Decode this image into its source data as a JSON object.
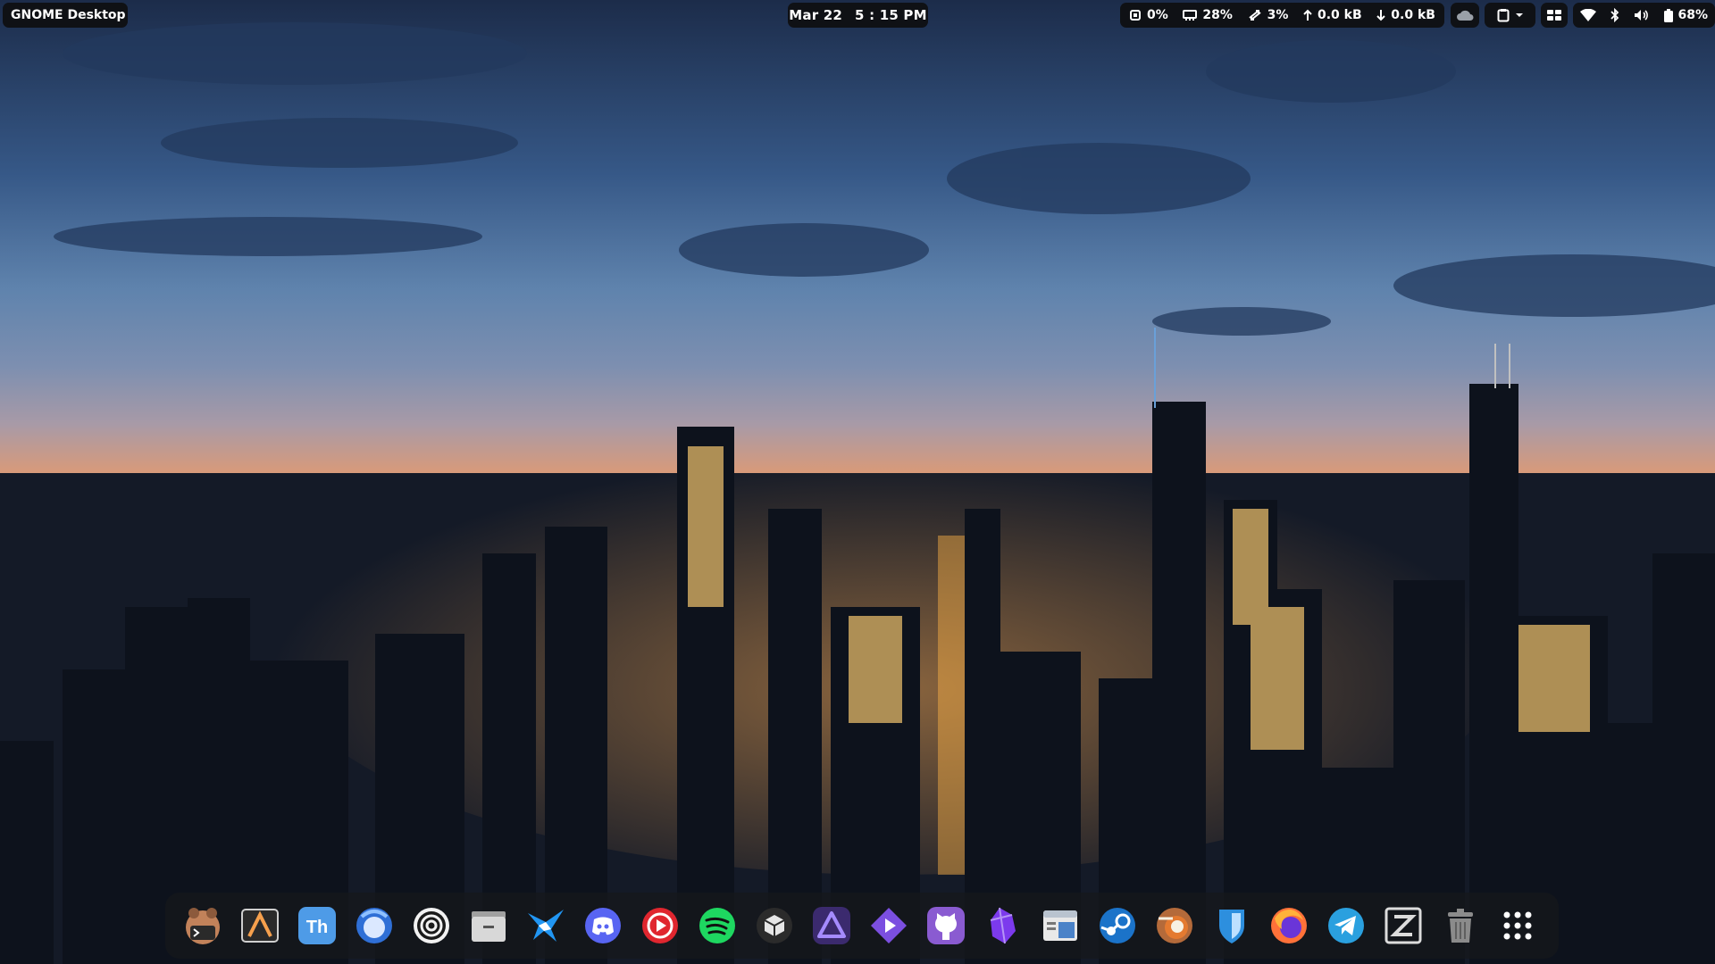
{
  "desktop": {
    "wallpaper": "city-skyline-dusk"
  },
  "top_bar": {
    "activities_label": "GNOME Desktop",
    "date": "Mar 22",
    "time": "5 : 15 PM",
    "system_monitor": {
      "cpu": "0%",
      "memory": "28%",
      "swap": "3%",
      "upload": "0.0 kB",
      "download": "0.0 kB"
    },
    "battery_percent": "68%"
  },
  "dock": {
    "apps": [
      {
        "id": "terminal-app",
        "icon": "terminal-icon",
        "color": "#c2825a"
      },
      {
        "id": "text-editor-app",
        "icon": "text-editor-icon",
        "color": "#f6a04d"
      },
      {
        "id": "thunderbird-app",
        "icon": "th-icon",
        "label": "Th",
        "color": "#4e9be7"
      },
      {
        "id": "mail-app",
        "icon": "mail-client-icon",
        "color": "#2f6fd6"
      },
      {
        "id": "obs-app",
        "icon": "obs-studio-icon",
        "color": "#1b1b1b"
      },
      {
        "id": "files-app",
        "icon": "files-icon",
        "color": "#cfcfcf"
      },
      {
        "id": "kdeconnect-app",
        "icon": "bird-icon",
        "color": "#2196f3"
      },
      {
        "id": "discord-app",
        "icon": "discord-icon",
        "color": "#5865f2"
      },
      {
        "id": "video-player-app",
        "icon": "play-icon",
        "color": "#e0262f"
      },
      {
        "id": "spotify-app",
        "icon": "spotify-icon",
        "color": "#1ed760"
      },
      {
        "id": "package-app",
        "icon": "package-icon",
        "color": "#2b2b2b"
      },
      {
        "id": "proton-vpn-app",
        "icon": "triangle-icon",
        "color": "#6d4aff"
      },
      {
        "id": "proton-pass-app",
        "icon": "diamond-icon",
        "color": "#7b4fe0"
      },
      {
        "id": "github-app",
        "icon": "github-icon",
        "color": "#8a5bd1"
      },
      {
        "id": "obsidian-app",
        "icon": "obsidian-icon",
        "color": "#7c3aed"
      },
      {
        "id": "window-manager-app",
        "icon": "window-icon",
        "color": "#e8e8e8"
      },
      {
        "id": "steam-app",
        "icon": "steam-icon",
        "color": "#1b73c9"
      },
      {
        "id": "blender-app",
        "icon": "blender-icon",
        "color": "#e47a30"
      },
      {
        "id": "bitwarden-app",
        "icon": "shield-icon",
        "color": "#2d8fde"
      },
      {
        "id": "firefox-app",
        "icon": "firefox-icon",
        "color": "#ff7139"
      },
      {
        "id": "telegram-app",
        "icon": "telegram-icon",
        "color": "#2aa0df"
      },
      {
        "id": "zed-app",
        "icon": "zed-icon",
        "color": "#dcdcdc"
      },
      {
        "id": "trash",
        "icon": "trash-icon",
        "color": "#8b8b8b"
      },
      {
        "id": "app-grid",
        "icon": "app-grid-icon",
        "color": "#ffffff"
      }
    ]
  }
}
